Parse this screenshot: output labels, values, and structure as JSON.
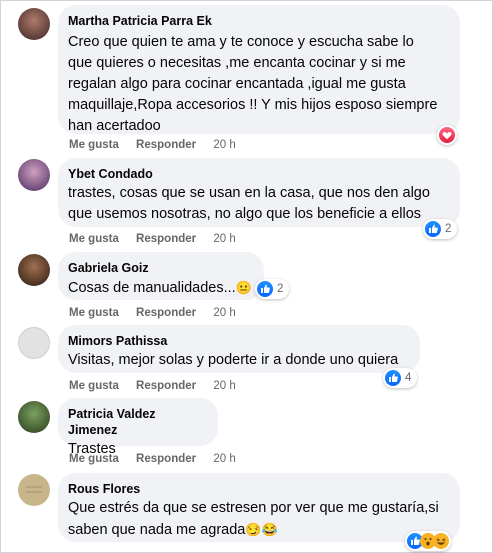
{
  "comments": [
    {
      "author": "Martha Patricia Parra Ek",
      "lines": [
        "Creo que quien te ama y te conoce y escucha sabe lo",
        "que quieres o necesitas ,me encanta cocinar y si me",
        "regalan algo para cocinar encantada ,igual me gusta",
        "maquillaje,Ropa accesorios !! Y mis hijos esposo siempre",
        "han acertadoo"
      ],
      "like": "Me gusta",
      "reply": "Responder",
      "time": "20 h",
      "reaction_count": "",
      "avatar_color": "#6b4a4a"
    },
    {
      "author": "Ybet Condado",
      "lines": [
        "trastes, cosas que se usan en la casa, que nos den algo",
        "que usemos nosotras, no algo que los beneficie a ellos"
      ],
      "like": "Me gusta",
      "reply": "Responder",
      "time": "20 h",
      "reaction_count": "2",
      "avatar_color": "#5d3f7a"
    },
    {
      "author": "Gabriela Goiz",
      "lines": [
        "Cosas de manualidades..."
      ],
      "like": "Me gusta",
      "reply": "Responder",
      "time": "20 h",
      "reaction_count": "2",
      "avatar_color": "#4a2a1a"
    },
    {
      "author": "Mimors Pathissa",
      "lines": [
        "Visitas, mejor solas y poderte ir a donde uno quiera"
      ],
      "like": "Me gusta",
      "reply": "Responder",
      "time": "20 h",
      "reaction_count": "4",
      "avatar_color": "#c9c9c9"
    },
    {
      "author": "Patricia Valdez Jimenez",
      "lines": [
        "Trastes"
      ],
      "like": "Me gusta",
      "reply": "Responder",
      "time": "20 h",
      "reaction_count": "",
      "avatar_color": "#3c5a2a"
    },
    {
      "author": "Rous Flores",
      "lines": [
        "Que estrés da que se estresen por ver que me gustaría,si",
        "saben que nada me agrada"
      ],
      "like": "",
      "reply": "",
      "time": "",
      "reaction_count": "",
      "avatar_color": "#c8b58a"
    }
  ],
  "emoji": {
    "gabriela": "😐",
    "rous": "😏😂"
  },
  "colors": {
    "bubble": "#f0f2f5",
    "like_blue": "#0866ff",
    "heart_red": "#e41e3f",
    "meta_gray": "#65676b"
  }
}
